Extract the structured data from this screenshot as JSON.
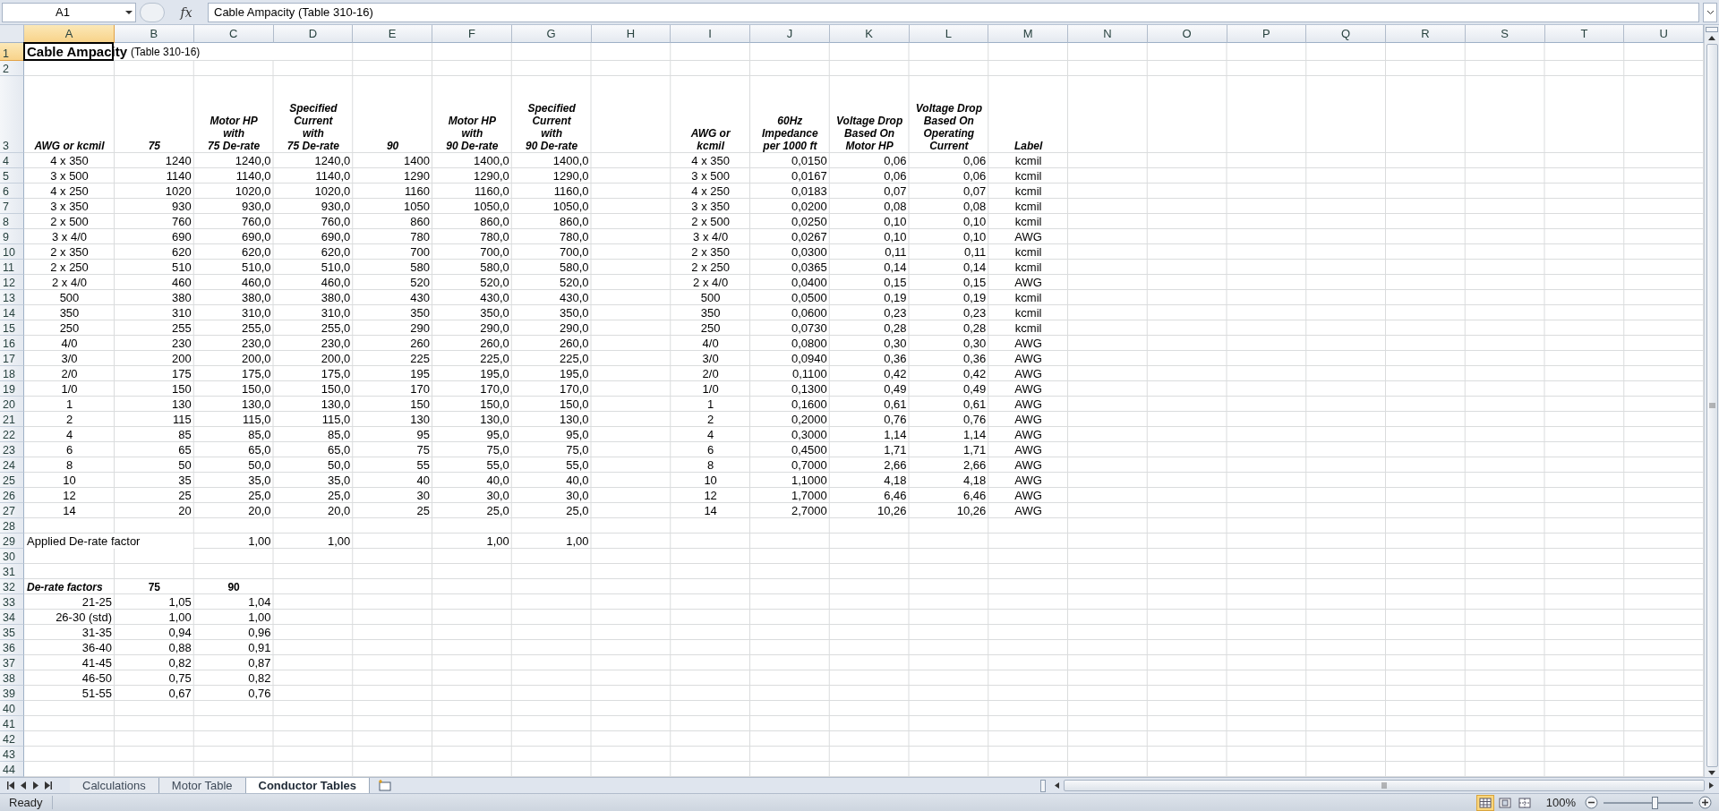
{
  "formula_bar": {
    "name_box": "A1",
    "function_label": "fx",
    "value": "Cable Ampacity (Table 310-16)"
  },
  "columns": [
    {
      "label": "A",
      "selected": true
    },
    {
      "label": "B",
      "selected": false
    },
    {
      "label": "C",
      "selected": false
    },
    {
      "label": "D",
      "selected": false
    },
    {
      "label": "E",
      "selected": false
    },
    {
      "label": "F",
      "selected": false
    },
    {
      "label": "G",
      "selected": false
    },
    {
      "label": "H",
      "selected": false
    },
    {
      "label": "I",
      "selected": false
    },
    {
      "label": "J",
      "selected": false
    },
    {
      "label": "K",
      "selected": false
    },
    {
      "label": "L",
      "selected": false
    },
    {
      "label": "M",
      "selected": false
    },
    {
      "label": "N",
      "selected": false
    },
    {
      "label": "O",
      "selected": false
    },
    {
      "label": "P",
      "selected": false
    },
    {
      "label": "Q",
      "selected": false
    },
    {
      "label": "R",
      "selected": false
    },
    {
      "label": "S",
      "selected": false
    },
    {
      "label": "T",
      "selected": false
    },
    {
      "label": "U",
      "selected": false
    }
  ],
  "rows": [
    {
      "n": "1",
      "selected": true,
      "kind": "title",
      "cells": {
        "A": "**Cable Ampacity** (Table 310-16)"
      }
    },
    {
      "n": "2",
      "selected": false
    },
    {
      "n": "3",
      "selected": false,
      "kind": "header",
      "cells": {
        "A": "AWG or kcmil",
        "B": "75",
        "C": "Motor HP\nwith\n75 De-rate",
        "D": "Specified\nCurrent\nwith\n75 De-rate",
        "E": "90",
        "F": "Motor HP\nwith\n90 De-rate",
        "G": "Specified\nCurrent\nwith\n90 De-rate",
        "I": "AWG or\nkcmil",
        "J": "60Hz\nImpedance\nper 1000 ft",
        "K": "Voltage Drop\nBased On\nMotor HP",
        "L": "Voltage Drop\nBased On\nOperating\nCurrent",
        "M": "Label"
      }
    },
    {
      "n": "4",
      "selected": false,
      "kind": "data",
      "cells": {
        "A": "4 x 350",
        "B": "1240",
        "C": "1240,0",
        "D": "1240,0",
        "E": "1400",
        "F": "1400,0",
        "G": "1400,0",
        "I": "4 x 350",
        "J": "0,0150",
        "K": "0,06",
        "L": "0,06",
        "M": "kcmil"
      }
    },
    {
      "n": "5",
      "selected": false,
      "kind": "data",
      "cells": {
        "A": "3 x 500",
        "B": "1140",
        "C": "1140,0",
        "D": "1140,0",
        "E": "1290",
        "F": "1290,0",
        "G": "1290,0",
        "I": "3 x 500",
        "J": "0,0167",
        "K": "0,06",
        "L": "0,06",
        "M": "kcmil"
      }
    },
    {
      "n": "6",
      "selected": false,
      "kind": "data",
      "cells": {
        "A": "4 x 250",
        "B": "1020",
        "C": "1020,0",
        "D": "1020,0",
        "E": "1160",
        "F": "1160,0",
        "G": "1160,0",
        "I": "4 x 250",
        "J": "0,0183",
        "K": "0,07",
        "L": "0,07",
        "M": "kcmil"
      }
    },
    {
      "n": "7",
      "selected": false,
      "kind": "data",
      "cells": {
        "A": "3 x 350",
        "B": "930",
        "C": "930,0",
        "D": "930,0",
        "E": "1050",
        "F": "1050,0",
        "G": "1050,0",
        "I": "3 x 350",
        "J": "0,0200",
        "K": "0,08",
        "L": "0,08",
        "M": "kcmil"
      }
    },
    {
      "n": "8",
      "selected": false,
      "kind": "data",
      "cells": {
        "A": "2 x 500",
        "B": "760",
        "C": "760,0",
        "D": "760,0",
        "E": "860",
        "F": "860,0",
        "G": "860,0",
        "I": "2 x 500",
        "J": "0,0250",
        "K": "0,10",
        "L": "0,10",
        "M": "kcmil"
      }
    },
    {
      "n": "9",
      "selected": false,
      "kind": "data",
      "cells": {
        "A": "3 x 4/0",
        "B": "690",
        "C": "690,0",
        "D": "690,0",
        "E": "780",
        "F": "780,0",
        "G": "780,0",
        "I": "3 x 4/0",
        "J": "0,0267",
        "K": "0,10",
        "L": "0,10",
        "M": "AWG"
      }
    },
    {
      "n": "10",
      "selected": false,
      "kind": "data",
      "cells": {
        "A": "2 x 350",
        "B": "620",
        "C": "620,0",
        "D": "620,0",
        "E": "700",
        "F": "700,0",
        "G": "700,0",
        "I": "2 x 350",
        "J": "0,0300",
        "K": "0,11",
        "L": "0,11",
        "M": "kcmil"
      }
    },
    {
      "n": "11",
      "selected": false,
      "kind": "data",
      "cells": {
        "A": "2 x 250",
        "B": "510",
        "C": "510,0",
        "D": "510,0",
        "E": "580",
        "F": "580,0",
        "G": "580,0",
        "I": "2 x 250",
        "J": "0,0365",
        "K": "0,14",
        "L": "0,14",
        "M": "kcmil"
      }
    },
    {
      "n": "12",
      "selected": false,
      "kind": "data",
      "cells": {
        "A": "2 x 4/0",
        "B": "460",
        "C": "460,0",
        "D": "460,0",
        "E": "520",
        "F": "520,0",
        "G": "520,0",
        "I": "2 x 4/0",
        "J": "0,0400",
        "K": "0,15",
        "L": "0,15",
        "M": "AWG"
      }
    },
    {
      "n": "13",
      "selected": false,
      "kind": "data",
      "cells": {
        "A": "500",
        "B": "380",
        "C": "380,0",
        "D": "380,0",
        "E": "430",
        "F": "430,0",
        "G": "430,0",
        "I": "500",
        "J": "0,0500",
        "K": "0,19",
        "L": "0,19",
        "M": "kcmil"
      }
    },
    {
      "n": "14",
      "selected": false,
      "kind": "data",
      "cells": {
        "A": "350",
        "B": "310",
        "C": "310,0",
        "D": "310,0",
        "E": "350",
        "F": "350,0",
        "G": "350,0",
        "I": "350",
        "J": "0,0600",
        "K": "0,23",
        "L": "0,23",
        "M": "kcmil"
      }
    },
    {
      "n": "15",
      "selected": false,
      "kind": "data",
      "cells": {
        "A": "250",
        "B": "255",
        "C": "255,0",
        "D": "255,0",
        "E": "290",
        "F": "290,0",
        "G": "290,0",
        "I": "250",
        "J": "0,0730",
        "K": "0,28",
        "L": "0,28",
        "M": "kcmil"
      }
    },
    {
      "n": "16",
      "selected": false,
      "kind": "data",
      "cells": {
        "A": "4/0",
        "B": "230",
        "C": "230,0",
        "D": "230,0",
        "E": "260",
        "F": "260,0",
        "G": "260,0",
        "I": "4/0",
        "J": "0,0800",
        "K": "0,30",
        "L": "0,30",
        "M": "AWG"
      }
    },
    {
      "n": "17",
      "selected": false,
      "kind": "data",
      "cells": {
        "A": "3/0",
        "B": "200",
        "C": "200,0",
        "D": "200,0",
        "E": "225",
        "F": "225,0",
        "G": "225,0",
        "I": "3/0",
        "J": "0,0940",
        "K": "0,36",
        "L": "0,36",
        "M": "AWG"
      }
    },
    {
      "n": "18",
      "selected": false,
      "kind": "data",
      "cells": {
        "A": "2/0",
        "B": "175",
        "C": "175,0",
        "D": "175,0",
        "E": "195",
        "F": "195,0",
        "G": "195,0",
        "I": "2/0",
        "J": "0,1100",
        "K": "0,42",
        "L": "0,42",
        "M": "AWG"
      }
    },
    {
      "n": "19",
      "selected": false,
      "kind": "data",
      "cells": {
        "A": "1/0",
        "B": "150",
        "C": "150,0",
        "D": "150,0",
        "E": "170",
        "F": "170,0",
        "G": "170,0",
        "I": "1/0",
        "J": "0,1300",
        "K": "0,49",
        "L": "0,49",
        "M": "AWG"
      }
    },
    {
      "n": "20",
      "selected": false,
      "kind": "data",
      "cells": {
        "A": "1",
        "B": "130",
        "C": "130,0",
        "D": "130,0",
        "E": "150",
        "F": "150,0",
        "G": "150,0",
        "I": "1",
        "J": "0,1600",
        "K": "0,61",
        "L": "0,61",
        "M": "AWG"
      }
    },
    {
      "n": "21",
      "selected": false,
      "kind": "data",
      "cells": {
        "A": "2",
        "B": "115",
        "C": "115,0",
        "D": "115,0",
        "E": "130",
        "F": "130,0",
        "G": "130,0",
        "I": "2",
        "J": "0,2000",
        "K": "0,76",
        "L": "0,76",
        "M": "AWG"
      }
    },
    {
      "n": "22",
      "selected": false,
      "kind": "data",
      "cells": {
        "A": "4",
        "B": "85",
        "C": "85,0",
        "D": "85,0",
        "E": "95",
        "F": "95,0",
        "G": "95,0",
        "I": "4",
        "J": "0,3000",
        "K": "1,14",
        "L": "1,14",
        "M": "AWG"
      }
    },
    {
      "n": "23",
      "selected": false,
      "kind": "data",
      "cells": {
        "A": "6",
        "B": "65",
        "C": "65,0",
        "D": "65,0",
        "E": "75",
        "F": "75,0",
        "G": "75,0",
        "I": "6",
        "J": "0,4500",
        "K": "1,71",
        "L": "1,71",
        "M": "AWG"
      }
    },
    {
      "n": "24",
      "selected": false,
      "kind": "data",
      "cells": {
        "A": "8",
        "B": "50",
        "C": "50,0",
        "D": "50,0",
        "E": "55",
        "F": "55,0",
        "G": "55,0",
        "I": "8",
        "J": "0,7000",
        "K": "2,66",
        "L": "2,66",
        "M": "AWG"
      }
    },
    {
      "n": "25",
      "selected": false,
      "kind": "data",
      "cells": {
        "A": "10",
        "B": "35",
        "C": "35,0",
        "D": "35,0",
        "E": "40",
        "F": "40,0",
        "G": "40,0",
        "I": "10",
        "J": "1,1000",
        "K": "4,18",
        "L": "4,18",
        "M": "AWG"
      }
    },
    {
      "n": "26",
      "selected": false,
      "kind": "data",
      "cells": {
        "A": "12",
        "B": "25",
        "C": "25,0",
        "D": "25,0",
        "E": "30",
        "F": "30,0",
        "G": "30,0",
        "I": "12",
        "J": "1,7000",
        "K": "6,46",
        "L": "6,46",
        "M": "AWG"
      }
    },
    {
      "n": "27",
      "selected": false,
      "kind": "data",
      "cells": {
        "A": "14",
        "B": "20",
        "C": "20,0",
        "D": "20,0",
        "E": "25",
        "F": "25,0",
        "G": "25,0",
        "I": "14",
        "J": "2,7000",
        "K": "10,26",
        "L": "10,26",
        "M": "AWG"
      }
    },
    {
      "n": "28",
      "selected": false
    },
    {
      "n": "29",
      "selected": false,
      "kind": "total",
      "cells": {
        "A": "Applied De-rate factor",
        "C": "1,00",
        "D": "1,00",
        "F": "1,00",
        "G": "1,00"
      }
    },
    {
      "n": "30",
      "selected": false
    },
    {
      "n": "31",
      "selected": false
    },
    {
      "n": "32",
      "selected": false,
      "kind": "factor-header",
      "cells": {
        "A": "De-rate factors",
        "B": "75",
        "C": "90"
      }
    },
    {
      "n": "33",
      "selected": false,
      "kind": "factor",
      "cells": {
        "A": "21-25",
        "B": "1,05",
        "C": "1,04"
      }
    },
    {
      "n": "34",
      "selected": false,
      "kind": "factor",
      "cells": {
        "A": "26-30 (std)",
        "B": "1,00",
        "C": "1,00"
      }
    },
    {
      "n": "35",
      "selected": false,
      "kind": "factor",
      "cells": {
        "A": "31-35",
        "B": "0,94",
        "C": "0,96"
      }
    },
    {
      "n": "36",
      "selected": false,
      "kind": "factor",
      "cells": {
        "A": "36-40",
        "B": "0,88",
        "C": "0,91"
      }
    },
    {
      "n": "37",
      "selected": false,
      "kind": "factor",
      "cells": {
        "A": "41-45",
        "B": "0,82",
        "C": "0,87"
      }
    },
    {
      "n": "38",
      "selected": false,
      "kind": "factor",
      "cells": {
        "A": "46-50",
        "B": "0,75",
        "C": "0,82"
      }
    },
    {
      "n": "39",
      "selected": false,
      "kind": "factor",
      "cells": {
        "A": "51-55",
        "B": "0,67",
        "C": "0,76"
      }
    },
    {
      "n": "40",
      "selected": false
    },
    {
      "n": "41",
      "selected": false
    },
    {
      "n": "42",
      "selected": false
    },
    {
      "n": "43",
      "selected": false
    },
    {
      "n": "44",
      "selected": false
    }
  ],
  "sheet_tabs": [
    {
      "label": "Calculations",
      "selected": false
    },
    {
      "label": "Motor Table",
      "selected": false
    },
    {
      "label": "Conductor Tables",
      "selected": true
    }
  ],
  "status_bar": {
    "status": "Ready",
    "views": [
      {
        "kind": "normal",
        "selected": true
      },
      {
        "kind": "page-layout",
        "selected": false
      },
      {
        "kind": "page-break",
        "selected": false
      }
    ],
    "zoom": "100%",
    "zoom_slider": {
      "level": 0.57
    }
  }
}
